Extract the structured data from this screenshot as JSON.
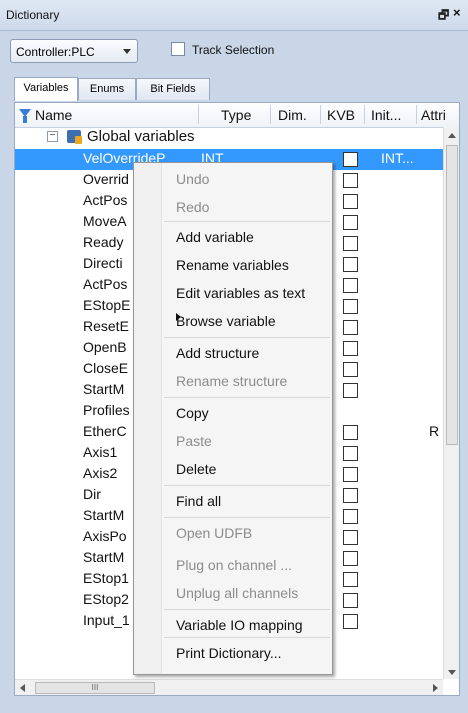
{
  "window": {
    "title": "Dictionary",
    "pin_glyph": "🗗",
    "close_glyph": "×"
  },
  "toolbar": {
    "controller_value": "Controller:PLC",
    "track_label": "Track Selection"
  },
  "tabs": [
    {
      "label": "Variables"
    },
    {
      "label": "Enums"
    },
    {
      "label": "Bit Fields"
    }
  ],
  "columns": [
    "Name",
    "Type",
    "Dim.",
    "KVB",
    "Init...",
    "Attri"
  ],
  "group": {
    "label": "Global variables",
    "toggle": "−"
  },
  "rows": [
    {
      "name": "VelOverrideP",
      "type": "INT",
      "init": "INT...",
      "selected": true,
      "attr": ""
    },
    {
      "name": "Overrid",
      "attr": ""
    },
    {
      "name": "ActPos",
      "attr": ""
    },
    {
      "name": "MoveA",
      "attr": ""
    },
    {
      "name": "Ready",
      "attr": ""
    },
    {
      "name": "Directi",
      "attr": ""
    },
    {
      "name": "ActPos",
      "attr": ""
    },
    {
      "name": "EStopE",
      "attr": ""
    },
    {
      "name": "ResetE",
      "attr": ""
    },
    {
      "name": "OpenB",
      "attr": ""
    },
    {
      "name": "CloseE",
      "attr": ""
    },
    {
      "name": "StartM",
      "attr": ""
    },
    {
      "name": "Profiles",
      "attr": ""
    },
    {
      "name": "EtherC",
      "attr": "R"
    },
    {
      "name": "Axis1",
      "attr": ""
    },
    {
      "name": "Axis2",
      "attr": ""
    },
    {
      "name": "Dir",
      "attr": ""
    },
    {
      "name": "StartM",
      "attr": ""
    },
    {
      "name": "AxisPo",
      "attr": ""
    },
    {
      "name": "StartM",
      "attr": ""
    },
    {
      "name": "EStop1",
      "attr": ""
    },
    {
      "name": "EStop2",
      "attr": ""
    },
    {
      "name": "Input_1",
      "attr": ""
    }
  ],
  "scrollbar": {
    "h_thumb_grip": "III"
  },
  "context_menu": {
    "items": [
      {
        "label": "Undo",
        "disabled": true
      },
      {
        "label": "Redo",
        "disabled": true
      },
      {
        "label": "Add variable",
        "disabled": false
      },
      {
        "label": "Rename variables",
        "disabled": false
      },
      {
        "label": "Edit variables as text",
        "disabled": false
      },
      {
        "label": "Browse variable",
        "disabled": false,
        "submenu": true
      },
      {
        "label": "Add structure",
        "disabled": false
      },
      {
        "label": "Rename structure",
        "disabled": true
      },
      {
        "label": "Copy",
        "disabled": false
      },
      {
        "label": "Paste",
        "disabled": true
      },
      {
        "label": "Delete",
        "disabled": false
      },
      {
        "label": "Find all",
        "disabled": false
      },
      {
        "label": "Open UDFB",
        "disabled": true
      },
      {
        "label": "Plug on channel ...",
        "disabled": true
      },
      {
        "label": "Unplug all channels",
        "disabled": true
      },
      {
        "label": "Variable IO mapping",
        "disabled": false
      },
      {
        "label": "Print Dictionary...",
        "disabled": false
      }
    ]
  },
  "colors": {
    "selection": "#3399ff",
    "panel_bg": "#c9d6e7"
  }
}
